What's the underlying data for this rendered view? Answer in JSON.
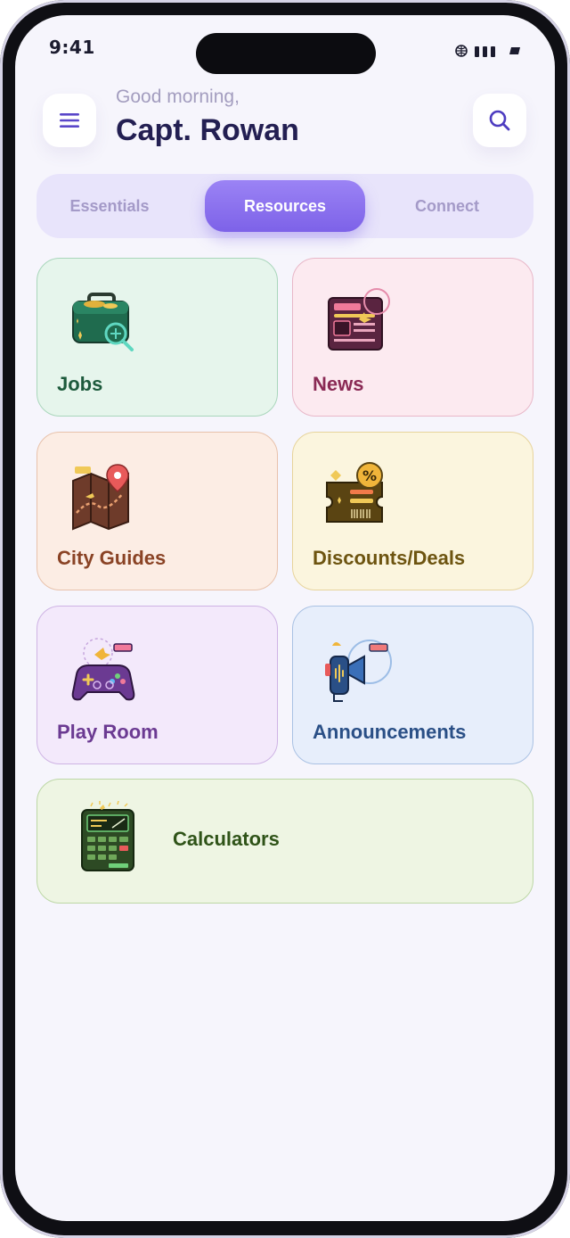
{
  "status_bar": {
    "time": "9:41"
  },
  "header": {
    "greeting": "Good morning,",
    "user_name": "Capt. Rowan",
    "menu_icon": "hamburger-menu-icon",
    "search_icon": "search-icon"
  },
  "tabs": [
    {
      "label": "Essentials",
      "selected": false
    },
    {
      "label": "Resources",
      "selected": true
    },
    {
      "label": "Connect",
      "selected": false
    }
  ],
  "cards": [
    {
      "label": "Jobs",
      "icon": "toolbox-search-icon",
      "color": "#1d5a3c"
    },
    {
      "label": "News",
      "icon": "newspaper-icon",
      "color": "#8a2a55"
    },
    {
      "label": "City Guides",
      "icon": "map-pin-icon",
      "color": "#8a4325"
    },
    {
      "label": "Discounts/Deals",
      "icon": "ticket-percent-icon",
      "color": "#6d5410"
    },
    {
      "label": "Play Room",
      "icon": "gamepad-icon",
      "color": "#6b3a92"
    },
    {
      "label": "Announcements",
      "icon": "megaphone-icon",
      "color": "#2a4f86"
    },
    {
      "label": "Calculators",
      "icon": "calculator-icon",
      "color": "#2f5318"
    }
  ],
  "theme": {
    "accent": "#7d62e8",
    "background": "#f6f5fc"
  }
}
